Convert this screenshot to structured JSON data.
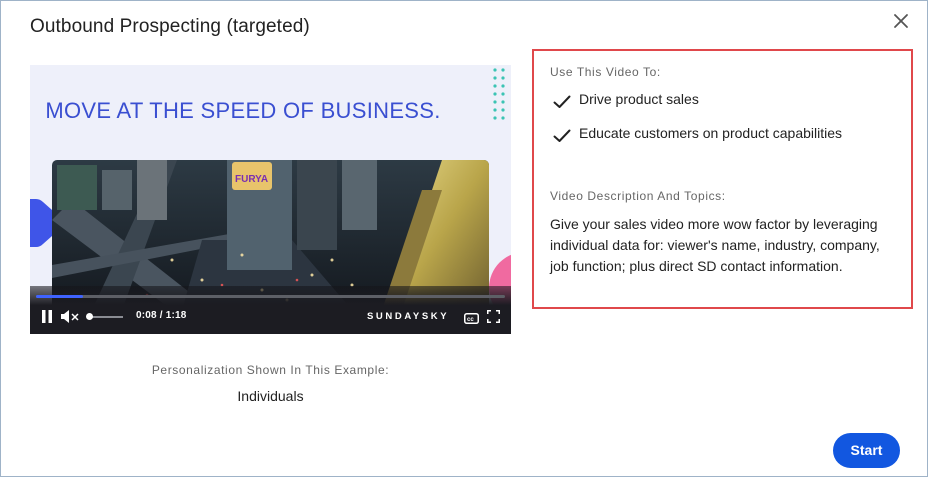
{
  "modal": {
    "title": "Outbound Prospecting (targeted)",
    "close_icon": "close-icon"
  },
  "video": {
    "headline": "MOVE AT THE SPEED OF BUSINESS.",
    "time_display": "0:08 / 1:18",
    "brand": "SUNDAYSKY",
    "progress": 0.1,
    "volume": 0.0,
    "accent_color": "#3a4fd1",
    "icons": [
      "pause-icon",
      "mute-icon",
      "captions-icon",
      "fullscreen-icon"
    ]
  },
  "personalization": {
    "label": "Personalization Shown In This Example:",
    "value": "Individuals"
  },
  "uses": {
    "label": "Use This Video To:",
    "items": [
      "Drive product sales",
      "Educate customers on product capabilities"
    ]
  },
  "description": {
    "label": "Video Description And Topics:",
    "text": "Give your sales video more wow factor by leveraging individual data for: viewer's name, industry, company, job function; plus direct SD contact information."
  },
  "actions": {
    "start_label": "Start",
    "start_color": "#1257e0"
  },
  "colors": {
    "highlight_border": "#e0484b"
  }
}
